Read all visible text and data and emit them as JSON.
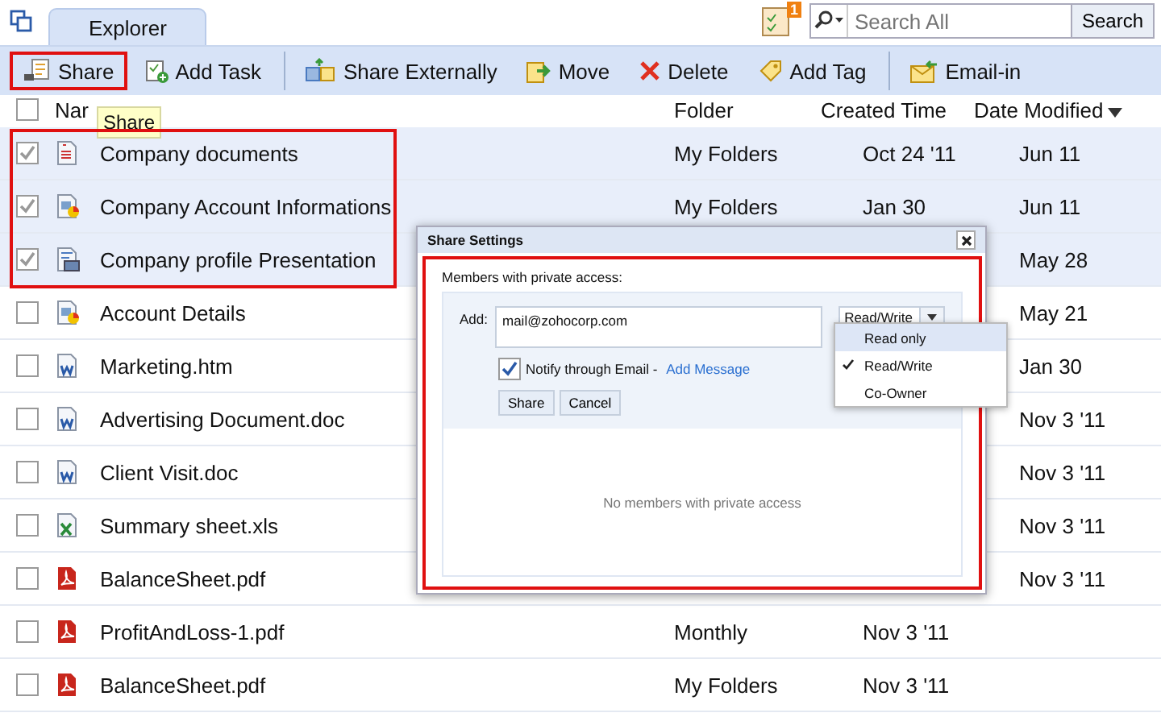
{
  "tabs": [
    {
      "label": "Explorer",
      "selected": true
    }
  ],
  "tasks_badge": "1",
  "search": {
    "placeholder": "Search All",
    "button": "Search"
  },
  "toolbar": [
    {
      "kind": "share",
      "label": "Share",
      "highlighted": true,
      "separator_before": false
    },
    {
      "kind": "task",
      "label": "Add Task",
      "highlighted": false,
      "separator_before": false
    },
    {
      "kind": "external",
      "label": "Share Externally",
      "highlighted": false,
      "separator_before": true
    },
    {
      "kind": "move",
      "label": "Move",
      "highlighted": false,
      "separator_before": false
    },
    {
      "kind": "delete",
      "label": "Delete",
      "highlighted": false,
      "separator_before": false
    },
    {
      "kind": "tag",
      "label": "Add Tag",
      "highlighted": false,
      "separator_before": false
    },
    {
      "kind": "email",
      "label": "Email-in",
      "highlighted": false,
      "separator_before": true
    }
  ],
  "tooltip": "Share",
  "table": {
    "select_all": {
      "checked": false
    },
    "columns": [
      {
        "label": "Nar",
        "sorted": false
      },
      {
        "label": "Folder",
        "sorted": false
      },
      {
        "label": "Created Time",
        "sorted": false
      },
      {
        "label": "Date Modified",
        "sorted": true
      }
    ],
    "rows": [
      {
        "kind": "doc",
        "name": "Company documents",
        "folder": "My Folders",
        "created": "Oct 24 '11",
        "modified": "Jun 11",
        "selected": true
      },
      {
        "kind": "sheetchart",
        "name": "Company Account Informations",
        "folder": "My Folders",
        "created": "Jan 30",
        "modified": "Jun 11",
        "selected": true
      },
      {
        "kind": "presentation",
        "name": "Company profile Presentation",
        "modified": "May 28",
        "selected": true
      },
      {
        "kind": "sheetchart",
        "name": "Account Details",
        "modified": "May 21",
        "selected": false
      },
      {
        "kind": "word",
        "name": "Marketing.htm",
        "modified": "Jan 30",
        "selected": false
      },
      {
        "kind": "word",
        "name": "Advertising Document.doc",
        "modified": "Nov 3 '11",
        "selected": false
      },
      {
        "kind": "word",
        "name": "Client Visit.doc",
        "modified": "Nov 3 '11",
        "selected": false
      },
      {
        "kind": "excel",
        "name": "Summary sheet.xls",
        "modified": "Nov 3 '11",
        "selected": false
      },
      {
        "kind": "pdf",
        "name": "BalanceSheet.pdf",
        "modified": "Nov 3 '11",
        "selected": false
      },
      {
        "kind": "pdf",
        "name": "ProfitAndLoss-1.pdf",
        "folder": "Monthly",
        "created": "Nov 3 '11",
        "selected": false
      },
      {
        "kind": "pdf",
        "name": "BalanceSheet.pdf",
        "folder": "My Folders",
        "created": "Nov 3 '11",
        "selected": false
      }
    ]
  },
  "dialog": {
    "title": "Share Settings",
    "section_label": "Members with private access:",
    "add_label": "Add:",
    "email": "mail@zohocorp.com",
    "permission": "Read/Write",
    "permission_options": [
      {
        "label": "Read only",
        "highlighted": true,
        "checked": false
      },
      {
        "label": "Read/Write",
        "highlighted": false,
        "checked": true
      },
      {
        "label": "Co-Owner",
        "highlighted": false,
        "checked": false
      }
    ],
    "notify": {
      "checked": true,
      "label": "Notify through Email - ",
      "link": "Add Message"
    },
    "buttons": [
      "Share",
      "Cancel"
    ],
    "empty_message": "No members with private access"
  }
}
